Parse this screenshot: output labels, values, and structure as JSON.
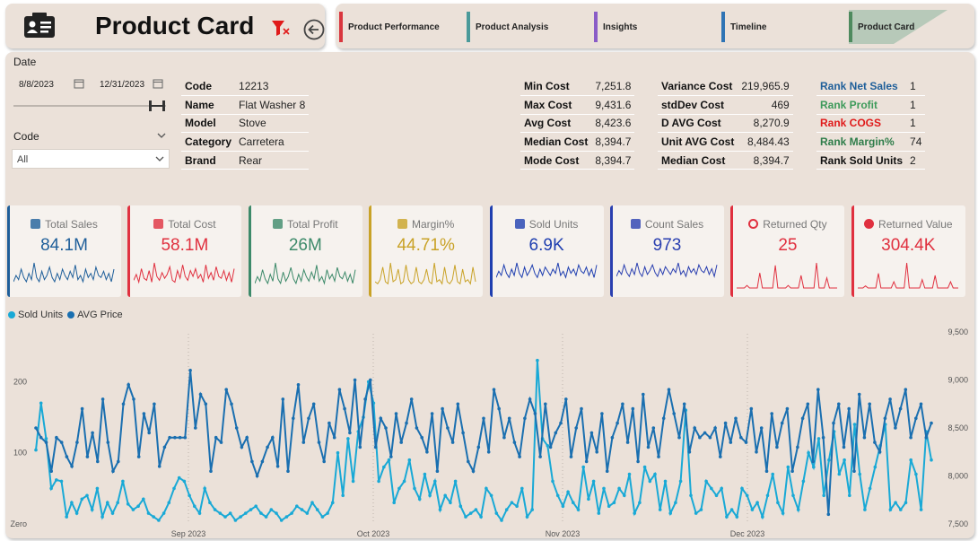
{
  "header": {
    "title": "Product Card"
  },
  "nav": [
    {
      "label": "Product Performance",
      "color": "#d9363e"
    },
    {
      "label": "Product Analysis",
      "color": "#4a9a9a"
    },
    {
      "label": "Insights",
      "color": "#8a5cc7"
    },
    {
      "label": "Timeline",
      "color": "#2f74b5"
    },
    {
      "label": "Product Card",
      "color": "#4e8a5e",
      "active": true
    }
  ],
  "slicers": {
    "date_label": "Date",
    "date_start": "8/8/2023",
    "date_end": "12/31/2023",
    "code_label": "Code",
    "code_value": "All"
  },
  "product": [
    {
      "key": "Code",
      "value": "12213"
    },
    {
      "key": "Name",
      "value": "Flat Washer 8"
    },
    {
      "key": "Model",
      "value": "Stove"
    },
    {
      "key": "Category",
      "value": "Carretera"
    },
    {
      "key": "Brand",
      "value": "Rear"
    }
  ],
  "cost_stats_1": [
    {
      "key": "Min Cost",
      "value": "7,251.8"
    },
    {
      "key": "Max Cost",
      "value": "9,431.6"
    },
    {
      "key": "Avg Cost",
      "value": "8,423.6"
    },
    {
      "key": "Median Cost",
      "value": "8,394.7"
    },
    {
      "key": "Mode Cost",
      "value": "8,394.7"
    }
  ],
  "cost_stats_2": [
    {
      "key": "Variance Cost",
      "value": "219,965.9"
    },
    {
      "key": "stdDev Cost",
      "value": "469"
    },
    {
      "key": "D AVG Cost",
      "value": "8,270.9"
    },
    {
      "key": "Unit AVG Cost",
      "value": "8,484.43"
    },
    {
      "key": "Median Cost",
      "value": "8,394.7"
    }
  ],
  "ranks": [
    {
      "key": "Rank Net Sales",
      "value": "1",
      "color": "#1f5f9a"
    },
    {
      "key": "Rank Profit",
      "value": "1",
      "color": "#3d9a5a"
    },
    {
      "key": "Rank COGS",
      "value": "1",
      "color": "#e01a1a"
    },
    {
      "key": "Rank Margin%",
      "value": "74",
      "color": "#2f7d4a"
    },
    {
      "key": "Rank Sold Units",
      "value": "2",
      "color": "#111111"
    }
  ],
  "kpis": [
    {
      "label": "Total Sales",
      "value": "84.1M",
      "color": "#1f5f9a",
      "icon": "cash-icon"
    },
    {
      "label": "Total Cost",
      "value": "58.1M",
      "color": "#e0303f",
      "icon": "box-icon"
    },
    {
      "label": "Total Profit",
      "value": "26M",
      "color": "#3d8a6a",
      "icon": "money-icon"
    },
    {
      "label": "Margin%",
      "value": "44.71%",
      "color": "#c9a227",
      "icon": "chart-up-icon"
    },
    {
      "label": "Sold Units",
      "value": "6.9K",
      "color": "#1f3fb0",
      "icon": "truck-icon"
    },
    {
      "label": "Count Sales",
      "value": "973",
      "color": "#2a3fb0",
      "icon": "calendar-icon"
    },
    {
      "label": "Returned Qty",
      "value": "25",
      "color": "#e0303f",
      "icon": "ring-icon"
    },
    {
      "label": "Returned Value",
      "value": "304.4K",
      "color": "#e0303f",
      "icon": "red-dot-icon"
    }
  ],
  "chart_data": {
    "type": "line",
    "legend_position": "top-left",
    "x_ticks": [
      "Sep 2023",
      "Oct 2023",
      "Nov 2023",
      "Dec 2023"
    ],
    "y_left_ticks": [
      "Zero",
      "100",
      "200"
    ],
    "y_right_ticks": [
      "7,500",
      "8,000",
      "8,500",
      "9,000",
      "9,500"
    ],
    "y_left_range": [
      0,
      270
    ],
    "y_right_range": [
      7500,
      9500
    ],
    "series": [
      {
        "name": "Sold Units",
        "color": "#19a9d6",
        "axis": "left",
        "values": [
          104,
          170,
          120,
          50,
          62,
          60,
          10,
          30,
          15,
          35,
          40,
          20,
          50,
          10,
          30,
          15,
          30,
          60,
          28,
          20,
          25,
          35,
          15,
          10,
          5,
          15,
          30,
          50,
          65,
          60,
          40,
          25,
          15,
          50,
          30,
          20,
          15,
          10,
          15,
          5,
          10,
          15,
          20,
          25,
          15,
          10,
          20,
          15,
          5,
          10,
          15,
          25,
          20,
          15,
          30,
          20,
          10,
          15,
          30,
          100,
          40,
          120,
          60,
          130,
          150,
          200,
          170,
          60,
          80,
          90,
          30,
          50,
          60,
          90,
          50,
          35,
          70,
          40,
          60,
          20,
          40,
          30,
          60,
          25,
          10,
          15,
          20,
          10,
          50,
          40,
          15,
          5,
          20,
          30,
          25,
          50,
          10,
          20,
          230,
          120,
          110,
          60,
          40,
          25,
          45,
          30,
          20,
          80,
          35,
          60,
          15,
          50,
          25,
          30,
          50,
          40,
          70,
          15,
          30,
          80,
          60,
          70,
          20,
          60,
          15,
          30,
          60,
          160,
          40,
          15,
          20,
          60,
          50,
          40,
          50,
          10,
          20,
          10,
          50,
          40,
          20,
          30,
          10,
          40,
          70,
          30,
          15,
          80,
          40,
          20,
          60,
          100,
          80,
          120,
          40,
          90,
          130,
          70,
          90,
          40,
          140,
          70,
          20,
          50,
          80,
          110,
          140,
          20,
          30,
          20,
          30,
          90,
          70,
          20,
          130,
          90
        ]
      },
      {
        "name": "AVG Price",
        "color": "#1a6fb0",
        "axis": "right",
        "values": [
          8500,
          8400,
          8350,
          8050,
          8400,
          8350,
          8200,
          8100,
          8350,
          8700,
          8200,
          8450,
          8150,
          8800,
          8350,
          8050,
          8150,
          8750,
          8950,
          8800,
          8200,
          8650,
          8450,
          8750,
          8100,
          8300,
          8400,
          8400,
          8400,
          8400,
          9100,
          8500,
          8850,
          8750,
          8050,
          8400,
          8350,
          8900,
          8750,
          8500,
          8300,
          8400,
          8150,
          8000,
          8150,
          8300,
          8400,
          8100,
          8800,
          8050,
          8600,
          8950,
          8350,
          8600,
          8750,
          8350,
          8150,
          8550,
          8400,
          8900,
          8700,
          8450,
          9000,
          8300,
          8800,
          9000,
          8300,
          8600,
          8500,
          8200,
          8650,
          8350,
          8550,
          8800,
          8500,
          8400,
          8250,
          8650,
          8050,
          8700,
          8500,
          8350,
          8750,
          8450,
          8150,
          8050,
          8300,
          8600,
          8250,
          8900,
          8700,
          8400,
          8600,
          8350,
          8200,
          8600,
          8800,
          8650,
          8200,
          8750,
          8300,
          8450,
          8550,
          8800,
          8200,
          8500,
          8700,
          8150,
          8450,
          8250,
          8650,
          8050,
          8400,
          8550,
          8750,
          8350,
          8700,
          8150,
          8850,
          8300,
          8500,
          8200,
          8600,
          8900,
          8650,
          8400,
          8750,
          8250,
          8500,
          8400,
          8450,
          8400,
          8500,
          8200,
          8550,
          8350,
          8600,
          8400,
          8350,
          8700,
          8250,
          8500,
          8050,
          8650,
          8300,
          8550,
          8700,
          8050,
          8300,
          8600,
          8750,
          8150,
          8900,
          8400,
          7600,
          8550,
          8750,
          8300,
          8700,
          8050,
          8850,
          8400,
          8750,
          8350,
          8250,
          8600,
          8800,
          8500,
          8700,
          8900,
          8400,
          8600,
          8750,
          8400,
          8550
        ]
      }
    ]
  }
}
